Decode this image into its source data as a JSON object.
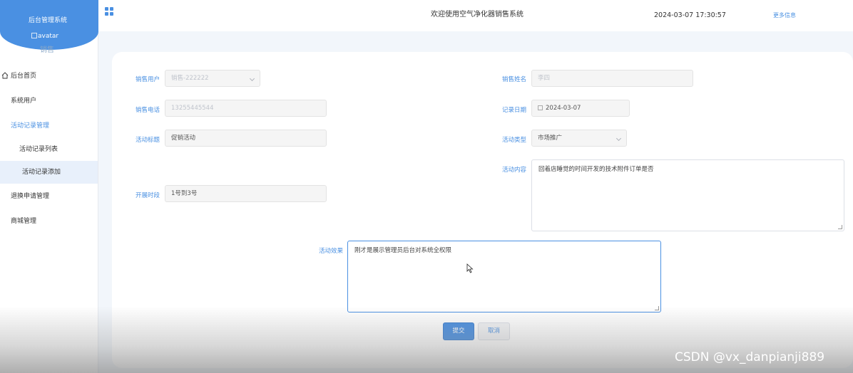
{
  "sidebar": {
    "title": "后台管理系统",
    "avatar_alt": "avatar",
    "role": "销售",
    "items": [
      {
        "label": "后台首页"
      },
      {
        "label": "系统用户"
      },
      {
        "label": "活动记录管理"
      },
      {
        "label": "活动记录列表"
      },
      {
        "label": "活动记录添加"
      },
      {
        "label": "退换申请管理"
      },
      {
        "label": "商城管理"
      }
    ]
  },
  "header": {
    "title": "欢迎使用空气净化器销售系统",
    "datetime": "2024-03-07 17:30:57",
    "more": "更多信息"
  },
  "form": {
    "sales_user": {
      "label": "销售用户",
      "value": "销售-222222"
    },
    "sales_name": {
      "label": "销售姓名",
      "value": "李四"
    },
    "sales_phone": {
      "label": "销售电话",
      "value": "13255445544"
    },
    "record_date": {
      "label": "记录日期",
      "value": "2024-03-07"
    },
    "activity_title": {
      "label": "活动标题",
      "value": "促销活动"
    },
    "activity_type": {
      "label": "活动类型",
      "value": "市场推广"
    },
    "activity_content": {
      "label": "活动内容",
      "value": "回着店睡觉的时间开发的技术附件订单是否"
    },
    "period": {
      "label": "开展时段",
      "value": "1号到3号"
    },
    "activity_effect": {
      "label": "活动效果",
      "value": "刚才是展示管理员后台对系统全权限"
    },
    "submit": "提交",
    "cancel": "取消"
  },
  "watermark": "CSDN @vx_danpianji889",
  "colors": {
    "accent": "#4a90e2",
    "sidebar_head": "#4a90e2"
  }
}
